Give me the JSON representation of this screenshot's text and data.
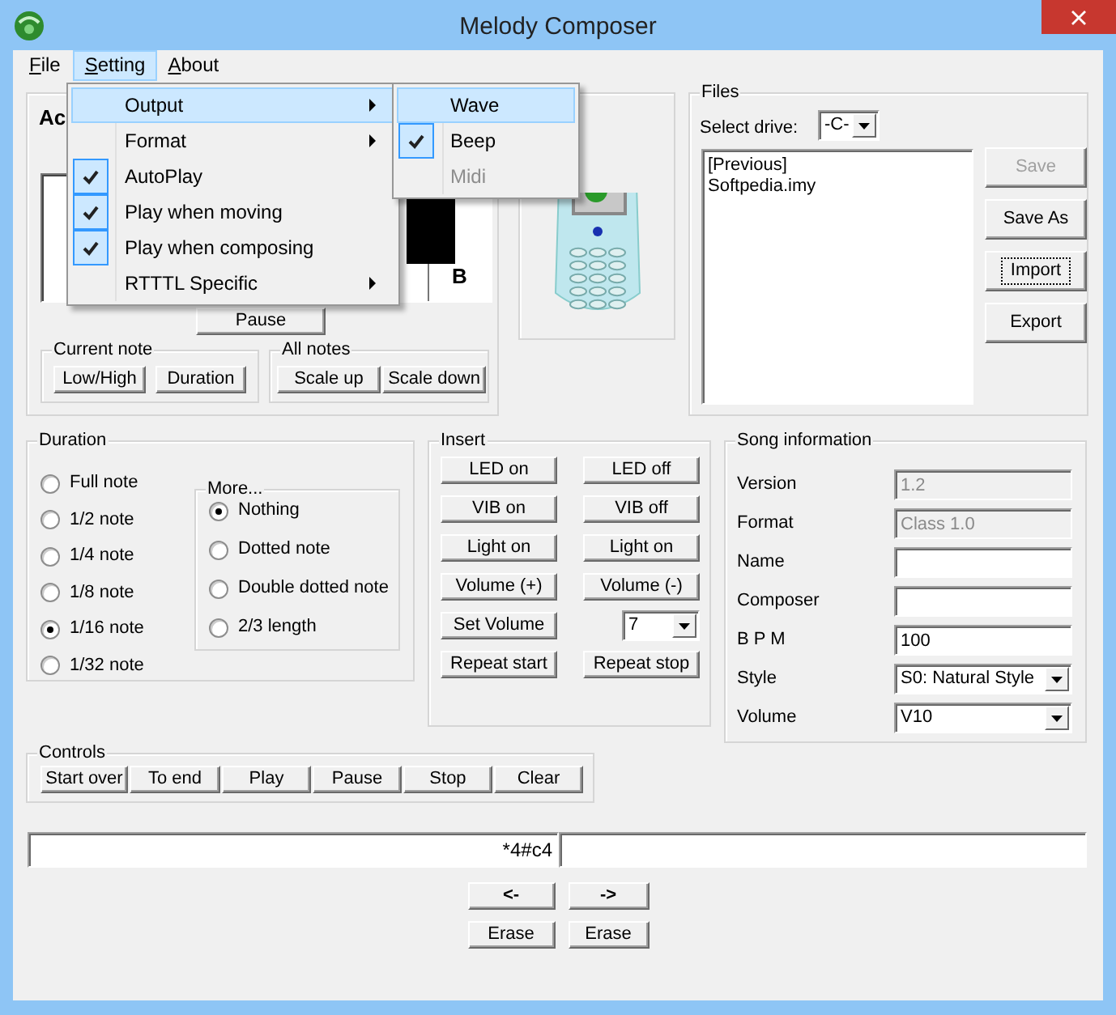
{
  "window": {
    "title": "Melody Composer"
  },
  "menu_bar": [
    {
      "label": "File",
      "selected": false
    },
    {
      "label": "Setting",
      "selected": true
    },
    {
      "label": "About",
      "selected": false
    }
  ],
  "setting_menu": [
    {
      "label": "Output",
      "kind": "submenu",
      "selected": true,
      "checked": false
    },
    {
      "label": "Format",
      "kind": "submenu",
      "selected": false,
      "checked": false
    },
    {
      "label": "AutoPlay",
      "kind": "check",
      "selected": false,
      "checked": true
    },
    {
      "label": "Play when moving",
      "kind": "check",
      "selected": false,
      "checked": true
    },
    {
      "label": "Play when composing",
      "kind": "check",
      "selected": false,
      "checked": true
    },
    {
      "label": "RTTTL Specific",
      "kind": "submenu",
      "selected": false,
      "checked": false
    }
  ],
  "output_submenu": [
    {
      "label": "Wave",
      "selected": true,
      "checked": false,
      "disabled": false
    },
    {
      "label": "Beep",
      "selected": false,
      "checked": true,
      "disabled": false
    },
    {
      "label": "Midi",
      "selected": false,
      "checked": false,
      "disabled": true
    }
  ],
  "keyboard_panel": {
    "heading": "Ac",
    "key_label": "B",
    "pause_button": "Pause",
    "current_note": {
      "title": "Current note",
      "buttons": [
        "Low/High",
        "Duration"
      ]
    },
    "all_notes": {
      "title": "All notes",
      "buttons": [
        "Scale up",
        "Scale down"
      ]
    }
  },
  "files": {
    "title": "Files",
    "drive_label": "Select drive:",
    "drive": "-C-",
    "list": [
      "[Previous]",
      "Softpedia.imy"
    ],
    "buttons": [
      {
        "label": "Save",
        "disabled": true,
        "focused": false
      },
      {
        "label": "Save As",
        "disabled": false,
        "focused": false
      },
      {
        "label": "Import",
        "disabled": false,
        "focused": true
      },
      {
        "label": "Export",
        "disabled": false,
        "focused": false
      }
    ]
  },
  "duration": {
    "title": "Duration",
    "options": [
      {
        "label": "Full note",
        "selected": false
      },
      {
        "label": "1/2 note",
        "selected": false
      },
      {
        "label": "1/4 note",
        "selected": false
      },
      {
        "label": "1/8 note",
        "selected": false
      },
      {
        "label": "1/16 note",
        "selected": true
      },
      {
        "label": "1/32 note",
        "selected": false
      }
    ],
    "more": {
      "title": "More...",
      "options": [
        {
          "label": "Nothing",
          "selected": true
        },
        {
          "label": "Dotted note",
          "selected": false
        },
        {
          "label": "Double dotted note",
          "selected": false
        },
        {
          "label": "2/3 length",
          "selected": false
        }
      ]
    }
  },
  "insert": {
    "title": "Insert",
    "items": [
      {
        "kind": "button",
        "label": "LED on"
      },
      {
        "kind": "button",
        "label": "LED off"
      },
      {
        "kind": "button",
        "label": "VIB on"
      },
      {
        "kind": "button",
        "label": "VIB off"
      },
      {
        "kind": "button",
        "label": "Light on"
      },
      {
        "kind": "button",
        "label": "Light on"
      },
      {
        "kind": "button",
        "label": "Volume (+)"
      },
      {
        "kind": "button",
        "label": "Volume (-)"
      },
      {
        "kind": "button",
        "label": "Set Volume"
      },
      {
        "kind": "select",
        "value": "7"
      },
      {
        "kind": "button",
        "label": "Repeat start"
      },
      {
        "kind": "button",
        "label": "Repeat stop"
      }
    ]
  },
  "song_information": {
    "title": "Song information",
    "fields": [
      {
        "label": "Version",
        "kind": "text",
        "value": "1.2",
        "disabled": true
      },
      {
        "label": "Format",
        "kind": "text",
        "value": "Class 1.0",
        "disabled": true
      },
      {
        "label": "Name",
        "kind": "text",
        "disabled": false
      },
      {
        "label": "Composer",
        "kind": "text",
        "disabled": false
      },
      {
        "label": "B P M",
        "kind": "text",
        "value": "100",
        "disabled": false
      },
      {
        "label": "Style",
        "kind": "select",
        "value": "S0: Natural Style",
        "disabled": false
      },
      {
        "label": "Volume",
        "kind": "select",
        "value": "V10",
        "disabled": false
      }
    ]
  },
  "controls": {
    "title": "Controls",
    "buttons": [
      "Start over",
      "To end",
      "Play",
      "Pause",
      "Stop",
      "Clear"
    ]
  },
  "sequence": {
    "before_cursor": "*4#c4"
  },
  "navigation": {
    "move_buttons": [
      "<-",
      "->"
    ],
    "erase_buttons": [
      "Erase",
      "Erase"
    ]
  }
}
